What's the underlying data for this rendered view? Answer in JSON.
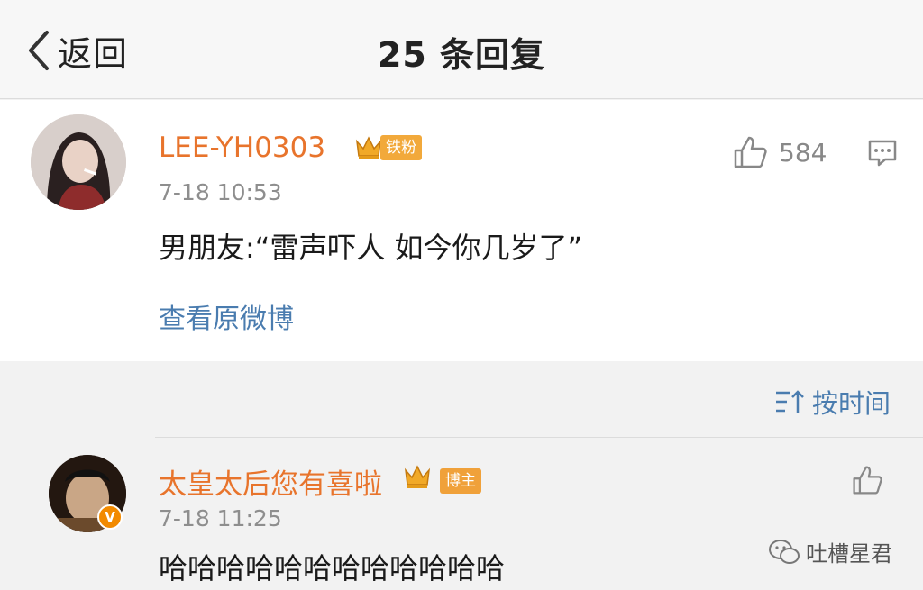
{
  "header": {
    "back_label": "返回",
    "title": "25 条回复"
  },
  "post": {
    "username": "LEE-YH0303",
    "badge": "铁粉",
    "timestamp": "7-18 10:53",
    "text": "男朋友:“雷声吓人 如今你几岁了”",
    "likes": "584",
    "view_original": "查看原微博"
  },
  "sort": {
    "label": "按时间"
  },
  "reply": {
    "username": "太皇太后您有喜啦",
    "badge": "博主",
    "timestamp": "7-18 11:25",
    "text": "哈哈哈哈哈哈哈哈哈哈哈哈"
  },
  "watermark": {
    "text": "吐槽星君"
  },
  "colors": {
    "username": "#e8742c",
    "link": "#4a7caf",
    "badge": "#f2a93b"
  },
  "icons": [
    "chevron-left-icon",
    "crown-icon",
    "thumbs-up-icon",
    "comment-icon",
    "sort-icon",
    "verified-icon",
    "wechat-icon"
  ]
}
